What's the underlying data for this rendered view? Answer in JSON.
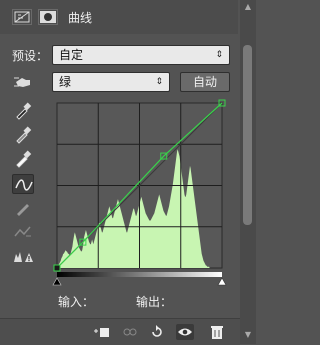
{
  "tabs": {
    "title": "曲线"
  },
  "preset": {
    "label": "预设：",
    "value": "自定"
  },
  "channel": {
    "value": "绿",
    "auto_label": "自动"
  },
  "io": {
    "input_label": "输入：",
    "output_label": "输出："
  },
  "colors": {
    "curve": "#39d34b",
    "histogram": "#c8f5b2",
    "graph_bg": "#585858"
  },
  "curve": {
    "points": [
      [
        0,
        0
      ],
      [
        40,
        40
      ],
      [
        165,
        173
      ],
      [
        255,
        255
      ]
    ],
    "histogram": [
      0,
      0,
      2,
      3,
      4,
      5,
      6,
      8,
      9,
      10,
      12,
      12,
      13,
      14,
      15,
      14,
      14,
      13,
      12,
      12,
      11,
      11,
      12,
      14,
      16,
      18,
      22,
      25,
      28,
      30,
      28,
      26,
      24,
      22,
      20,
      18,
      17,
      16,
      15,
      14,
      14,
      15,
      18,
      22,
      26,
      28,
      30,
      32,
      30,
      28,
      26,
      24,
      22,
      21,
      20,
      20,
      22,
      24,
      22,
      20,
      22,
      24,
      26,
      28,
      30,
      32,
      34,
      36,
      38,
      38,
      36,
      34,
      32,
      30,
      30,
      32,
      34,
      36,
      38,
      40,
      42,
      44,
      46,
      48,
      50,
      52,
      50,
      48,
      46,
      44,
      42,
      42,
      44,
      46,
      48,
      50,
      52,
      54,
      56,
      58,
      56,
      54,
      52,
      50,
      48,
      46,
      44,
      42,
      40,
      38,
      36,
      34,
      32,
      30,
      30,
      32,
      34,
      36,
      38,
      40,
      42,
      44,
      46,
      48,
      50,
      50,
      48,
      46,
      44,
      44,
      46,
      48,
      50,
      52,
      54,
      56,
      58,
      60,
      58,
      56,
      54,
      52,
      50,
      48,
      46,
      45,
      44,
      43,
      42,
      41,
      40,
      40,
      40,
      41,
      42,
      43,
      44,
      45,
      46,
      48,
      50,
      52,
      54,
      56,
      58,
      60,
      62,
      60,
      58,
      56,
      54,
      52,
      50,
      48,
      47,
      46,
      45,
      44,
      44,
      46,
      48,
      50,
      52,
      55,
      58,
      61,
      64,
      67,
      70,
      74,
      78,
      82,
      86,
      90,
      94,
      98,
      100,
      98,
      96,
      94,
      90,
      86,
      82,
      78,
      74,
      70,
      66,
      62,
      60,
      60,
      62,
      66,
      70,
      74,
      78,
      82,
      86,
      84,
      80,
      76,
      72,
      68,
      64,
      60,
      56,
      52,
      48,
      44,
      40,
      36,
      32,
      28,
      24,
      20,
      16,
      12,
      10,
      8,
      6,
      5,
      4,
      3,
      2,
      2,
      1,
      1,
      1,
      1,
      0,
      0,
      0,
      0,
      0,
      0,
      0,
      0,
      0,
      0,
      0,
      0,
      0,
      0,
      0,
      0,
      0,
      0,
      0,
      0,
      0
    ]
  }
}
